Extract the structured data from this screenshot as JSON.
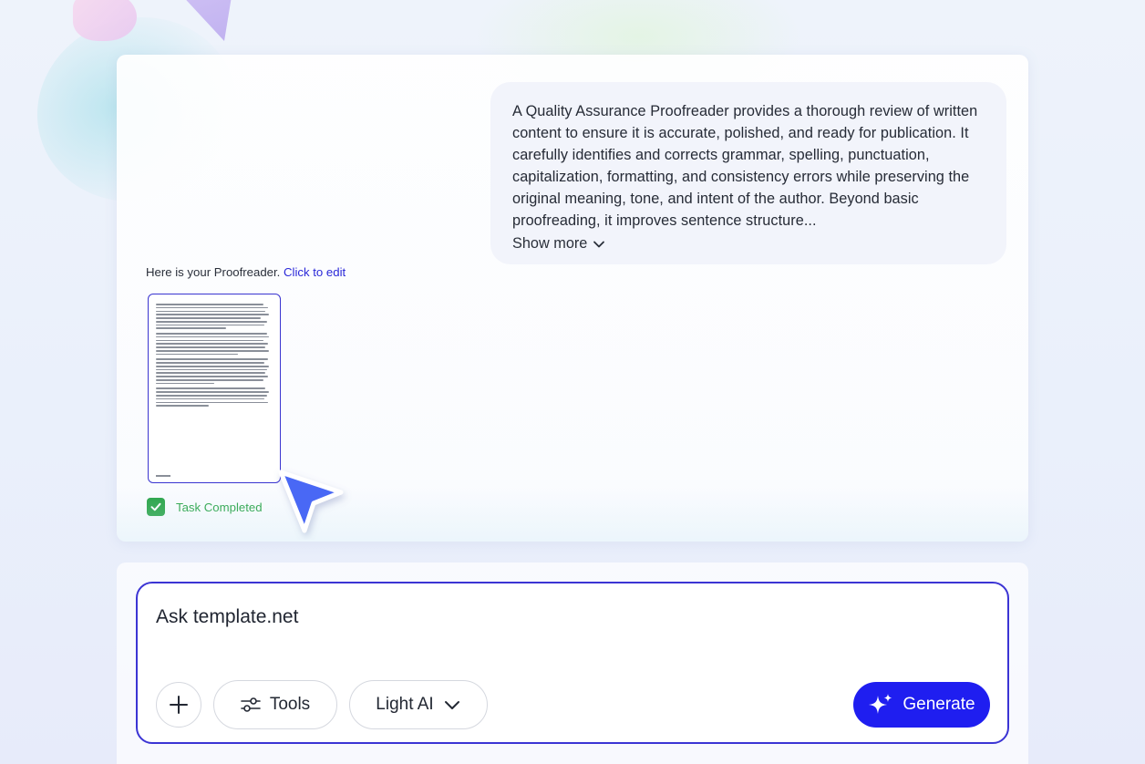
{
  "message": {
    "text": "A Quality Assurance Proofreader provides a thorough review of written content to ensure it is accurate, polished, and ready for publication. It carefully identifies and corrects grammar, spelling, punctuation, capitalization, formatting, and consistency errors while preserving the original meaning, tone, and intent of the author. Beyond basic proofreading, it improves sentence structure...",
    "show_more_label": "Show more"
  },
  "reply": {
    "intro": "Here is your Proofreader.",
    "edit_link": "Click to edit"
  },
  "task": {
    "status_label": "Task Completed",
    "status_color": "#25a244"
  },
  "composer": {
    "placeholder": "Ask template.net",
    "tools_label": "Tools",
    "model_label": "Light AI",
    "generate_label": "Generate"
  },
  "colors": {
    "accent": "#1f1ef0",
    "border_accent": "#3b34d4",
    "link": "#2a28d8"
  },
  "icons": [
    "plus-icon",
    "sliders-icon",
    "chevron-down-icon",
    "sparkle-icon",
    "check-icon",
    "pointer-cursor-icon"
  ]
}
